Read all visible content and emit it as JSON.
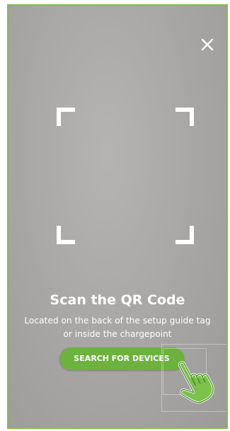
{
  "scanner": {
    "close_icon": "close-icon",
    "frame_icon": "qr-viewfinder-corner-icon",
    "title": "Scan the QR Code",
    "subtitle": "Located on the back of the setup guide tag or inside the chargepoint",
    "search_button_label": "SEARCH FOR DEVICES",
    "tap_hint_icon": "tap-hand-icon"
  },
  "colors": {
    "accent": "#6cb23d",
    "border": "#7fbe4a",
    "text": "#ffffff"
  }
}
